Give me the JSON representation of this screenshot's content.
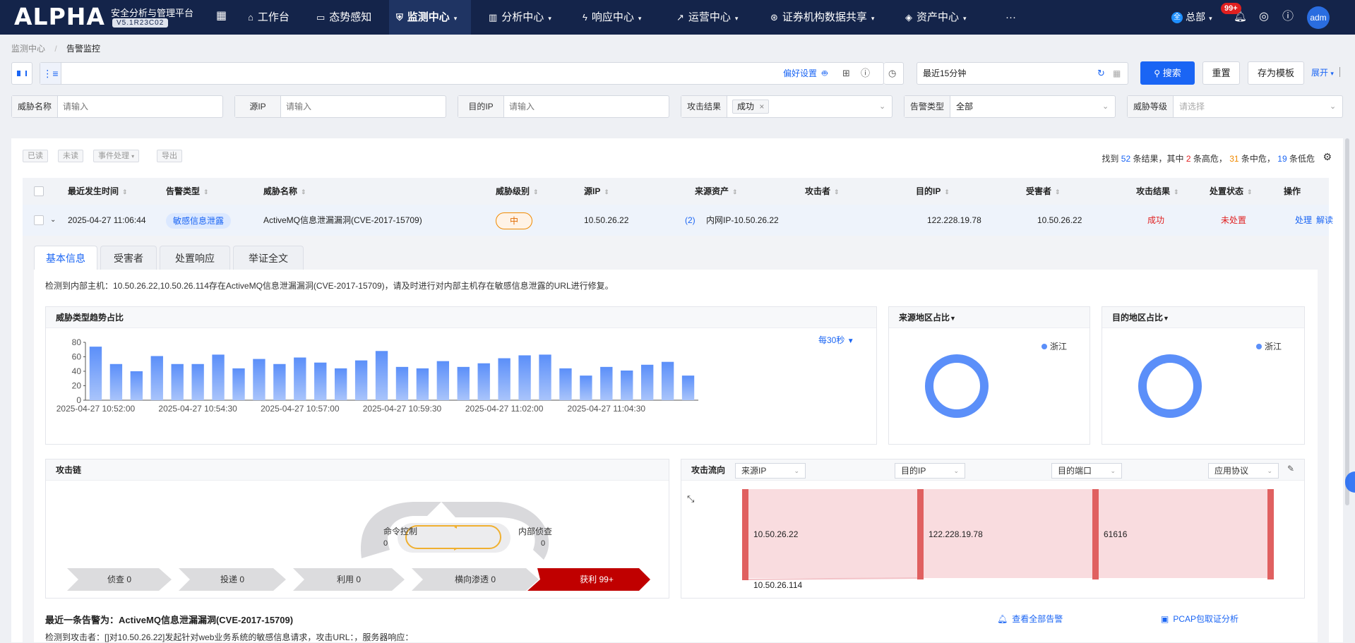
{
  "nav": {
    "logo": "ALPHA",
    "platform": "安全分析与管理平台",
    "version": "V5.1R23C02",
    "items": [
      {
        "label": "工作台",
        "icon": "home-icon"
      },
      {
        "label": "态势感知",
        "icon": "monitor-icon"
      },
      {
        "label": "监测中心",
        "icon": "shield-icon",
        "active": true
      },
      {
        "label": "分析中心",
        "icon": "chart-icon"
      },
      {
        "label": "响应中心",
        "icon": "bolt-icon"
      },
      {
        "label": "运营中心",
        "icon": "trend-icon"
      },
      {
        "label": "证券机构数据共享",
        "icon": "share-icon"
      },
      {
        "label": "资产中心",
        "icon": "layers-icon"
      }
    ],
    "more": "···",
    "tenant": "总部",
    "badge": "99+",
    "user": "adm"
  },
  "breadcrumb": {
    "root": "监测中心",
    "current": "告警监控"
  },
  "search": {
    "pref": "偏好设置",
    "time_range": "最近15分钟",
    "search_btn": "搜索",
    "reset_btn": "重置",
    "save_btn": "存为模板",
    "expand": "展开"
  },
  "filters": {
    "threat_name": {
      "label": "威胁名称",
      "placeholder": "请输入"
    },
    "src_ip": {
      "label": "源IP",
      "placeholder": "请输入"
    },
    "dst_ip": {
      "label": "目的IP",
      "placeholder": "请输入"
    },
    "attack_result": {
      "label": "攻击结果",
      "tag": "成功"
    },
    "alert_type": {
      "label": "告警类型",
      "value": "全部"
    },
    "threat_level": {
      "label": "威胁等级",
      "placeholder": "请选择"
    }
  },
  "toolbar": {
    "read": "已读",
    "unread": "未读",
    "event": "事件处理",
    "export": "导出"
  },
  "result": {
    "prefix": "找到",
    "total": "52",
    "mid1": "条结果，其中",
    "high": "2",
    "high_lbl": "条高危，",
    "medium": "31",
    "medium_lbl": "条中危，",
    "low": "19",
    "low_lbl": "条低危"
  },
  "table": {
    "headers": [
      "最近发生时间",
      "告警类型",
      "威胁名称",
      "威胁级别",
      "源IP",
      "来源资产",
      "攻击者",
      "目的IP",
      "受害者",
      "攻击结果",
      "处置状态",
      "操作"
    ],
    "row": {
      "time": "2025-04-27 11:06:44",
      "type": "敏感信息泄露",
      "name": "ActiveMQ信息泄漏漏洞(CVE-2017-15709)",
      "level": "中",
      "src_ip": "10.50.26.22",
      "src_count": "(2)",
      "asset": "内网IP-10.50.26.22",
      "dst_ip": "122.228.19.78",
      "victim": "10.50.26.22",
      "result": "成功",
      "status": "未处置",
      "op1": "处理",
      "op2": "解读"
    }
  },
  "detail": {
    "tabs": [
      "基本信息",
      "受害者",
      "处置响应",
      "举证全文"
    ],
    "summary": "检测到内部主机：10.50.26.22,10.50.26.114存在ActiveMQ信息泄漏漏洞(CVE-2017-15709)，请及时进行对内部主机存在敏感信息泄露的URL进行修复。",
    "trend_title": "威胁类型趋势占比",
    "interval": "每30秒",
    "src_region_title": "来源地区占比",
    "dst_region_title": "目的地区占比",
    "region_legend": "浙江",
    "chain_title": "攻击链",
    "chain": {
      "stages": [
        "侦查 0",
        "投递 0",
        "利用 0",
        "横向渗透 0"
      ],
      "cc_label": "命令控制",
      "cc_value": "0",
      "recon_label": "内部侦查",
      "recon_value": "0",
      "profit": "获利 99+"
    },
    "flow_title": "攻击流向",
    "flow_selects": [
      "来源IP",
      "目的IP",
      "目的端口",
      "应用协议"
    ],
    "flow_nodes": [
      "10.50.26.22",
      "122.228.19.78",
      "61616",
      "10.50.26.114"
    ],
    "latest_label": "最近一条告警为：ActiveMQ信息泄漏漏洞(CVE-2017-15709)",
    "latest_desc": "检测到攻击者：[]对10.50.26.22]发起针对web业务系统的敏感信息请求，攻击URL：，服务器响应：",
    "view_all": "查看全部告警",
    "pcap": "PCAP包取证分析"
  },
  "chart_data": {
    "type": "bar",
    "title": "威胁类型趋势占比",
    "xlabel": "",
    "ylabel": "",
    "ylim": [
      0,
      80
    ],
    "yticks": [
      0,
      20,
      40,
      60,
      80
    ],
    "x_tick_labels": [
      "2025-04-27 10:52:00",
      "2025-04-27 10:54:30",
      "2025-04-27 10:57:00",
      "2025-04-27 10:59:30",
      "2025-04-27 11:02:00",
      "2025-04-27 11:04:30"
    ],
    "values": [
      74,
      50,
      40,
      61,
      50,
      50,
      63,
      44,
      57,
      50,
      59,
      52,
      44,
      55,
      68,
      46,
      44,
      54,
      46,
      51,
      58,
      62,
      63,
      44,
      34,
      46,
      41,
      49,
      53,
      34
    ],
    "color": "#5b8ff9"
  },
  "donuts": [
    {
      "title": "来源地区占比",
      "legend": "浙江",
      "share": 1.0
    },
    {
      "title": "目的地区占比",
      "legend": "浙江",
      "share": 1.0
    }
  ]
}
